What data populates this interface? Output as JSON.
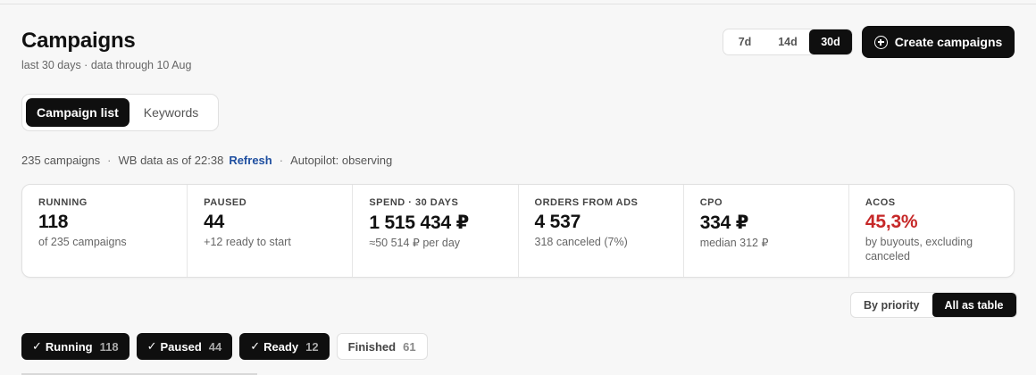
{
  "header": {
    "title": "Campaigns",
    "subtitle": "last 30 days · data through 10 Aug"
  },
  "range": {
    "options": [
      "7d",
      "14d",
      "30d"
    ],
    "selected": "30d"
  },
  "create_button": {
    "label": "Create campaigns",
    "icon": "plus-circle-icon"
  },
  "view_tabs": [
    {
      "label": "Campaign list",
      "active": true
    },
    {
      "label": "Keywords",
      "active": false
    }
  ],
  "status": {
    "count_text": "235 campaigns",
    "wb_text": "WB data as of 22:38",
    "refresh_label": "Refresh",
    "autopilot_text": "Autopilot: observing",
    "separator": "·"
  },
  "stats": [
    {
      "label": "RUNNING",
      "value": "118",
      "sub": "of 235 campaigns"
    },
    {
      "label": "PAUSED",
      "value": "44",
      "sub": "+12 ready to start"
    },
    {
      "label": "SPEND · 30 DAYS",
      "value": "1 515 434 ₽",
      "sub": "≈50 514 ₽ per day"
    },
    {
      "label": "ORDERS FROM ADS",
      "value": "4 537",
      "sub": "318 canceled (7%)"
    },
    {
      "label": "CPO",
      "value": "334 ₽",
      "sub": "median 312 ₽"
    },
    {
      "label": "ACOS",
      "value": "45,3%",
      "sub": "by buyouts, excluding canceled"
    }
  ],
  "acos_color": "#c62828",
  "layout_toggle": {
    "by_priority": "By priority",
    "all_as_table": "All as table",
    "selected": "All as table"
  },
  "filters": [
    {
      "label": "Running",
      "count": "118",
      "checked": true,
      "check": "✓"
    },
    {
      "label": "Paused",
      "count": "44",
      "checked": true,
      "check": "✓"
    },
    {
      "label": "Ready",
      "count": "12",
      "checked": true,
      "check": "✓"
    },
    {
      "label": "Finished",
      "count": "61",
      "checked": false
    }
  ]
}
